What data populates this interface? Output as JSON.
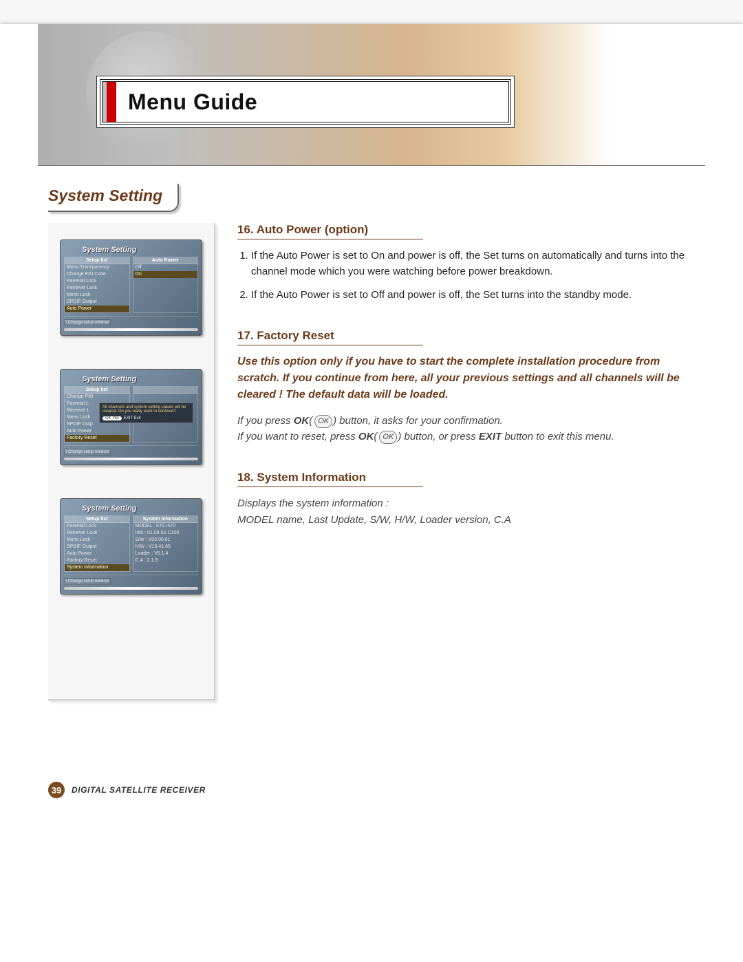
{
  "header": {
    "chapter_title": "Menu Guide",
    "section_title": "System Setting"
  },
  "topics": {
    "autopower": {
      "heading": "16. Auto Power (option)",
      "items": [
        "If the Auto Power is set to On and power is off, the Set turns on automatically and turns into the channel mode which you were watching before power breakdown.",
        "If the Auto Power is set to Off and power is off, the Set turns into the standby mode."
      ]
    },
    "factory": {
      "heading": "17. Factory Reset",
      "warning": "Use this option only if you have to start the complete installation procedure from scratch. If you continue from here, all your previous settings and all channels will be cleared ! The default data will be loaded.",
      "note_prefix": "If you press ",
      "note_mid1": " button, it asks for your confirmation.",
      "note_line2a": "If you want to reset, press ",
      "note_line2b": " button, or press ",
      "exit_label": "EXIT",
      "note_line2c": " button to exit this menu.",
      "ok_label": "OK"
    },
    "sysinfo": {
      "heading": "18. System Information",
      "body": "Displays the system information :\nMODEL name, Last Update, S/W, H/W, Loader version, C.A"
    }
  },
  "screenshots": {
    "title": "System Setting",
    "s1": {
      "left_head": "Setup list",
      "right_head": "Auto Power",
      "left_items": [
        "Menu Transparency",
        "Change PIN Code",
        "Parental Lock",
        "Receiver Lock",
        "Menu Lock",
        "SPDIF Output",
        "Auto Power"
      ],
      "right_items": [
        "Off",
        "On"
      ],
      "hint": "i  Change setup window"
    },
    "s2": {
      "left_items": [
        "Change PIN",
        "Parental L",
        "Receiver L",
        "Menu Lock",
        "SPDIF Outp",
        "Auto Power",
        "Factory Reset"
      ],
      "overlay": "All channels and system setting values will be cleared. Do you really want to continue?",
      "btn_ok": "OK   Yes",
      "btn_exit": "EXIT  Exit",
      "hint": "i  Change setup window"
    },
    "s3": {
      "left_head": "Setup list",
      "right_head": "System Information",
      "left_items": [
        "Parental Lock",
        "Receiver Lock",
        "Menu Lock",
        "SPDIF Output",
        "Auto Power",
        "Factory Reset",
        "System Information"
      ],
      "right_items": [
        "MODEL : KTC-570",
        "Info : 01.08.02-C100",
        "S/W : V03.00.01",
        "H/W : V13.41.65",
        "Loader : V5.1.4",
        "C.A : 2.1.9"
      ],
      "hint": "i  Change setup window"
    }
  },
  "footer": {
    "page_number": "39",
    "label": "DIGITAL SATELLITE RECEIVER"
  }
}
